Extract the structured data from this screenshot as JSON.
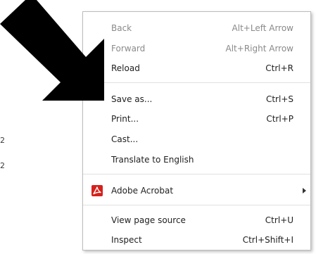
{
  "background": {
    "lines": [
      "2",
      "2"
    ]
  },
  "context_menu": {
    "items": [
      {
        "label": "Back",
        "shortcut": "Alt+Left Arrow"
      },
      {
        "label": "Forward",
        "shortcut": "Alt+Right Arrow"
      },
      {
        "label": "Reload",
        "shortcut": "Ctrl+R"
      },
      {
        "label": "Save as...",
        "shortcut": "Ctrl+S"
      },
      {
        "label": "Print...",
        "shortcut": "Ctrl+P"
      },
      {
        "label": "Cast...",
        "shortcut": ""
      },
      {
        "label": "Translate to English",
        "shortcut": ""
      },
      {
        "label": "Adobe Acrobat",
        "shortcut": "",
        "icon": "adobe-acrobat-icon"
      },
      {
        "label": "View page source",
        "shortcut": "Ctrl+U"
      },
      {
        "label": "Inspect",
        "shortcut": "Ctrl+Shift+I"
      }
    ]
  },
  "colors": {
    "arrow": "#000000",
    "acrobat_icon": "#d6201c",
    "disabled_text": "#8a8a8a"
  }
}
